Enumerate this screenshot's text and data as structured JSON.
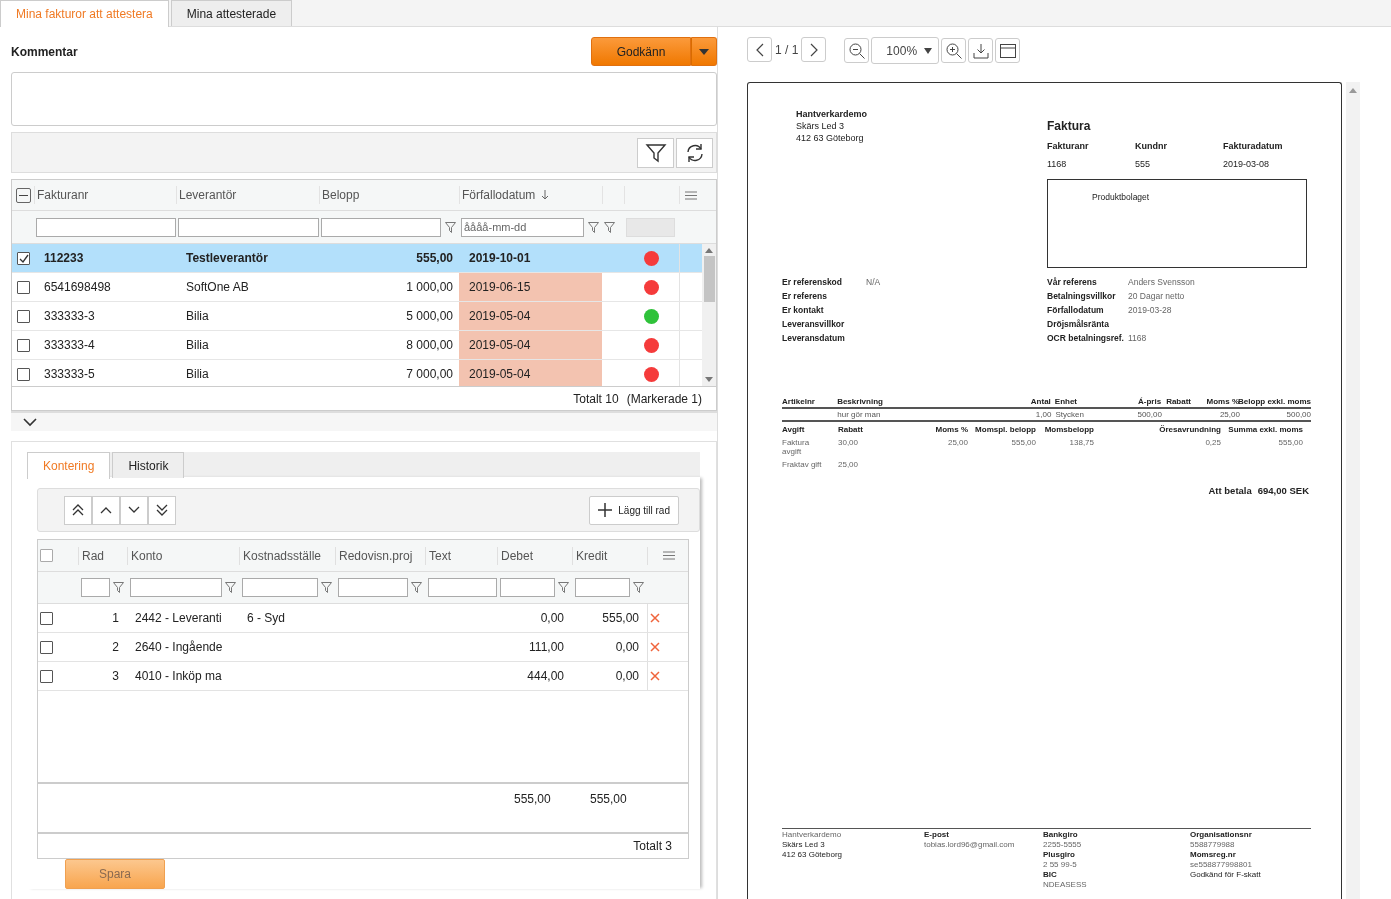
{
  "tabs": [
    {
      "label": "Mina fakturor att attestera",
      "selected": true
    },
    {
      "label": "Mina attesterade",
      "selected": false
    }
  ],
  "comment_label": "Kommentar",
  "approve_button": "Godkänn",
  "invoices": {
    "select_all_partial": true,
    "columns": [
      "Fakturanr",
      "Leverantör",
      "Belopp",
      "Förfallodatum"
    ],
    "date_placeholder": "åååå-mm-dd",
    "rows": [
      {
        "invoice_no": "112233",
        "supplier": "Testleverantör",
        "amount": "555,00",
        "due_date": "2019-10-01",
        "overdue": false,
        "selected": true,
        "checked": true,
        "color": "#f53b3b"
      },
      {
        "invoice_no": "6541698498",
        "supplier": "SoftOne AB",
        "amount": "1 000,00",
        "due_date": "2019-06-15",
        "overdue": true,
        "selected": false,
        "checked": false,
        "color": "#f53b3b"
      },
      {
        "invoice_no": "333333-3",
        "supplier": "Bilia",
        "amount": "5 000,00",
        "due_date": "2019-05-04",
        "overdue": true,
        "selected": false,
        "checked": false,
        "color": "#2fc23a"
      },
      {
        "invoice_no": "333333-4",
        "supplier": "Bilia",
        "amount": "8 000,00",
        "due_date": "2019-05-04",
        "overdue": true,
        "selected": false,
        "checked": false,
        "color": "#f53b3b"
      },
      {
        "invoice_no": "333333-5",
        "supplier": "Bilia",
        "amount": "7 000,00",
        "due_date": "2019-05-04",
        "overdue": true,
        "selected": false,
        "checked": false,
        "color": "#f53b3b"
      }
    ],
    "total": "Totalt 10",
    "marked": "(Markerade 1)"
  },
  "sub_tabs": [
    {
      "label": "Kontering",
      "selected": true
    },
    {
      "label": "Historik",
      "selected": false
    }
  ],
  "add_row_button": "Lägg till rad",
  "postings": {
    "select_all_checked": false,
    "columns": [
      "Rad",
      "Konto",
      "Kostnadsställe",
      "Redovisn.proj",
      "Text",
      "Debet",
      "Kredit"
    ],
    "rows": [
      {
        "row": "1",
        "account": "2442 - Leveranti",
        "cost_center": "6 - Syd",
        "debit": "0,00",
        "credit": "555,00",
        "checked": false
      },
      {
        "row": "2",
        "account": "2640 - Ingående",
        "debit": "111,00",
        "credit": "0,00",
        "checked": false
      },
      {
        "row": "3",
        "account": "4010 - Inköp ma",
        "debit": "444,00",
        "credit": "0,00",
        "checked": false
      }
    ],
    "sum_debit": "555,00",
    "sum_credit": "555,00",
    "total": "Totalt 3"
  },
  "save_button": "Spara",
  "viewer": {
    "page": "1 / 1",
    "zoom": "100%"
  },
  "document": {
    "sender": [
      "Hantverkardemo",
      "Skärs Led 3",
      "412 63 Göteborg"
    ],
    "title": "Faktura",
    "header_fields": [
      {
        "label": "Fakturanr",
        "value": "1168"
      },
      {
        "label": "Kundnr",
        "value": "555"
      },
      {
        "label": "Fakturadatum",
        "value": "2019-03-08"
      }
    ],
    "recipient": "Produktbolaget",
    "left_refs": [
      {
        "label": "Er referenskod",
        "value": "N/A"
      },
      {
        "label": "Er referens"
      },
      {
        "label": "Er kontakt"
      },
      {
        "label": "Leveransvillkor"
      },
      {
        "label": "Leveransdatum"
      }
    ],
    "right_refs": [
      {
        "label": "Vår referens",
        "value": "Anders Svensson"
      },
      {
        "label": "Betalningsvillkor",
        "value": "20 Dagar netto"
      },
      {
        "label": "Förfallodatum",
        "value": "2019-03-28"
      },
      {
        "label": "Dröjsmålsränta"
      },
      {
        "label": "OCR betalningsref.",
        "value": "1168"
      }
    ],
    "item_columns": [
      "Artikelnr",
      "Beskrivning",
      "Antal",
      "Enhet",
      "Á-pris",
      "Rabatt",
      "Moms %",
      "Belopp exkl. moms"
    ],
    "item_rows": [
      [
        null,
        "hur gör man",
        "1,00",
        "Stycken",
        "500,00",
        null,
        "25,00",
        "500,00"
      ]
    ],
    "fee_columns": [
      "Avgift",
      "Rabatt",
      "Moms %",
      "Momspl. belopp",
      "Momsbelopp",
      "Öresavrundning",
      "Summa exkl. moms"
    ],
    "fee_rows": [
      [
        "Faktura avgift",
        "30,00",
        "25,00",
        "555,00",
        "138,75",
        "0,25",
        "555,00"
      ],
      [
        "Fraktav gift",
        "25,00",
        null,
        null,
        null,
        null,
        null
      ]
    ],
    "to_pay_label": "Att betala",
    "to_pay": "694,00 SEK",
    "footer": [
      [
        {
          "kind": "plain",
          "text": "Hantverkardemo"
        },
        {
          "kind": "dark",
          "text": "Skärs Led 3"
        },
        {
          "kind": "dark",
          "text": "412 63 Göteborg"
        }
      ],
      [
        {
          "kind": "label",
          "text": "E-post"
        },
        {
          "kind": "plain",
          "text": "tobias.lord96@gmail.com"
        }
      ],
      [
        {
          "kind": "label",
          "text": "Bankgiro"
        },
        {
          "kind": "plain",
          "text": "2255-5555"
        },
        {
          "kind": "label",
          "text": "Plusgiro"
        },
        {
          "kind": "plain",
          "text": "2 55 99-5"
        },
        {
          "kind": "label",
          "text": "BIC"
        },
        {
          "kind": "plain",
          "text": "NDEASESS"
        }
      ],
      [
        {
          "kind": "label",
          "text": "Organisationsnr"
        },
        {
          "kind": "plain",
          "text": "5588779988"
        },
        {
          "kind": "label",
          "text": "Momsreg.nr"
        },
        {
          "kind": "plain",
          "text": "se558877998801"
        },
        {
          "kind": "dark",
          "text": "Godkänd för F-skatt"
        }
      ]
    ]
  }
}
